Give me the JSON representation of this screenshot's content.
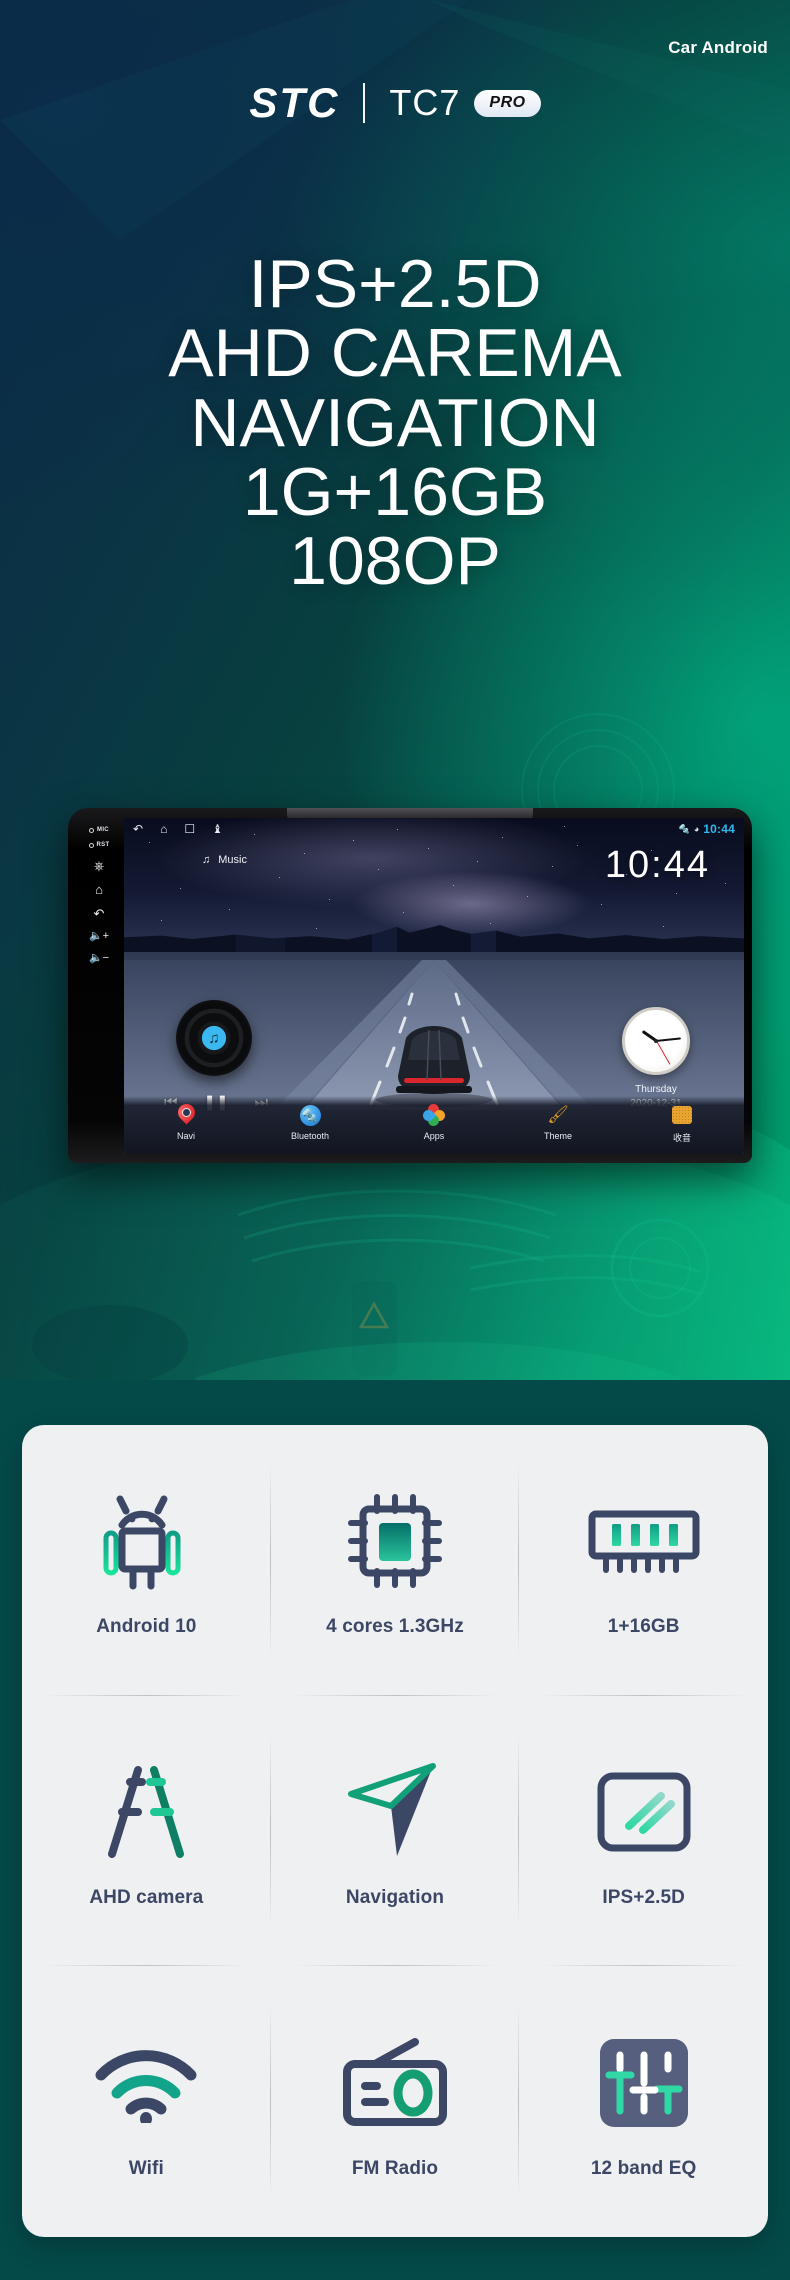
{
  "brand": {
    "logo": "STC",
    "model": "TC7",
    "badge": "PRO",
    "category": "Car Android"
  },
  "headline": {
    "lines": [
      "IPS+2.5D",
      "AHD CAREMA",
      "NAVIGATION",
      "1G+16GB",
      "108OP"
    ]
  },
  "colors": {
    "accent_teal": "#00a870",
    "deep_teal": "#044a49",
    "navy": "#0a2b45",
    "icon_navy": "#3c4765",
    "icon_green": "#16b37f",
    "status_blue": "#2fb9ef"
  },
  "head_unit": {
    "bezel": {
      "mic_label": "MIC",
      "rst_label": "RST",
      "power_icon": "power-icon",
      "home_icon": "home-icon",
      "back_icon": "back-icon",
      "volume_up_icon": "volume-up-icon",
      "volume_down_icon": "volume-down-icon"
    },
    "status_bar": {
      "back_icon": "back-arrow-icon",
      "home_icon": "home-icon",
      "recents_icon": "recents-icon",
      "usb_icon": "usb-icon",
      "bluetooth_icon": "bluetooth-icon",
      "wifi_icon": "wifi-icon",
      "time": "10:44"
    },
    "music_widget": {
      "label": "Music",
      "note_icon": "music-note-icon",
      "prev_icon": "previous-track-icon",
      "pause_icon": "pause-icon",
      "next_icon": "next-track-icon",
      "vinyl_icon": "vinyl-record-icon"
    },
    "clock_big": "10:44",
    "clock_widget": {
      "day": "Thursday",
      "date": "2020-12-31"
    },
    "dock": [
      {
        "label": "Navi",
        "icon": "map-pin-icon"
      },
      {
        "label": "Bluetooth",
        "icon": "bluetooth-icon"
      },
      {
        "label": "Apps",
        "icon": "apps-grid-icon"
      },
      {
        "label": "Theme",
        "icon": "paint-brush-icon"
      },
      {
        "label": "收音",
        "icon": "radio-icon"
      }
    ]
  },
  "specs": [
    {
      "label": "Android 10",
      "icon": "android-robot-icon"
    },
    {
      "label": "4 cores 1.3GHz",
      "icon": "cpu-chip-icon"
    },
    {
      "label": "1+16GB",
      "icon": "memory-ram-icon"
    },
    {
      "label": "AHD camera",
      "icon": "road-lanes-icon"
    },
    {
      "label": "Navigation",
      "icon": "navigation-arrow-icon"
    },
    {
      "label": "IPS+2.5D",
      "icon": "screen-glass-icon"
    },
    {
      "label": "Wifi",
      "icon": "wifi-icon"
    },
    {
      "label": "FM Radio",
      "icon": "radio-icon"
    },
    {
      "label": "12 band EQ",
      "icon": "equalizer-icon"
    }
  ]
}
